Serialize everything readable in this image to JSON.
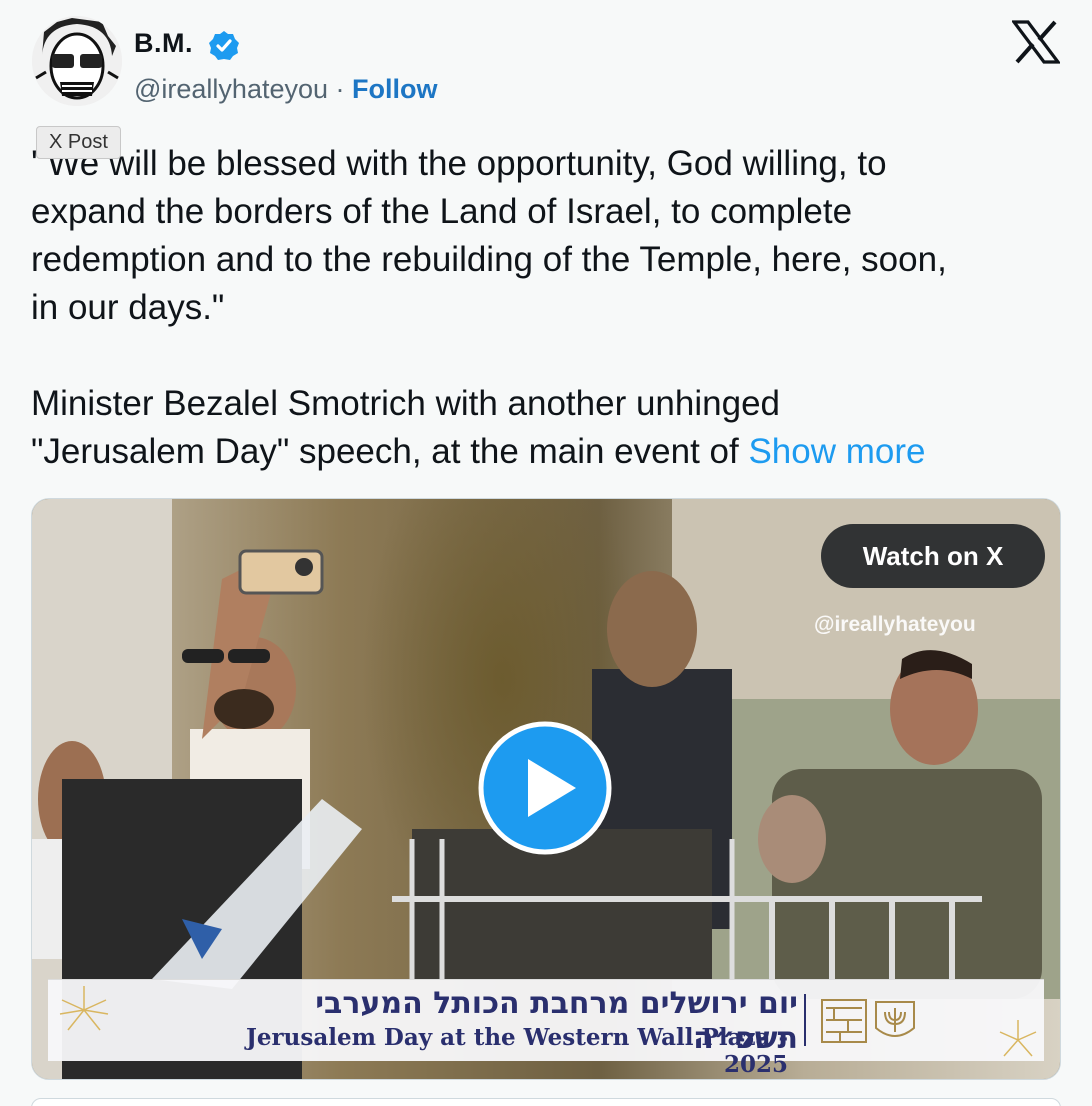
{
  "author": {
    "display_name": "B.M.",
    "handle": "@ireallyhateyou",
    "separator": "·",
    "follow_label": "Follow",
    "verified_color": "#1d9bf0"
  },
  "tooltip": "X Post",
  "tweet": {
    "text": "' We will be blessed with the opportunity, God willing, to\nexpand the borders of the Land of Israel, to complete\nredemption and to the rebuilding of the Temple, here, soon,\nin our days.\"\n\nMinister Bezalel Smotrich with another unhinged\n\"Jerusalem Day\" speech, at the main event of ",
    "show_more": "Show more"
  },
  "media": {
    "watch_label": "Watch on X",
    "watermark": "@ireallyhateyou",
    "play_icon": "play-circle-icon",
    "banner_hebrew": "יום ירושלים מרחבת הכותל המערבי תשפ״ה",
    "banner_english": "Jerusalem Day at the Western Wall Plaza - 2025"
  },
  "colors": {
    "link": "#1d9bf0",
    "text": "#0f1419",
    "muted": "#536471",
    "banner_text": "#2a2f6e"
  }
}
